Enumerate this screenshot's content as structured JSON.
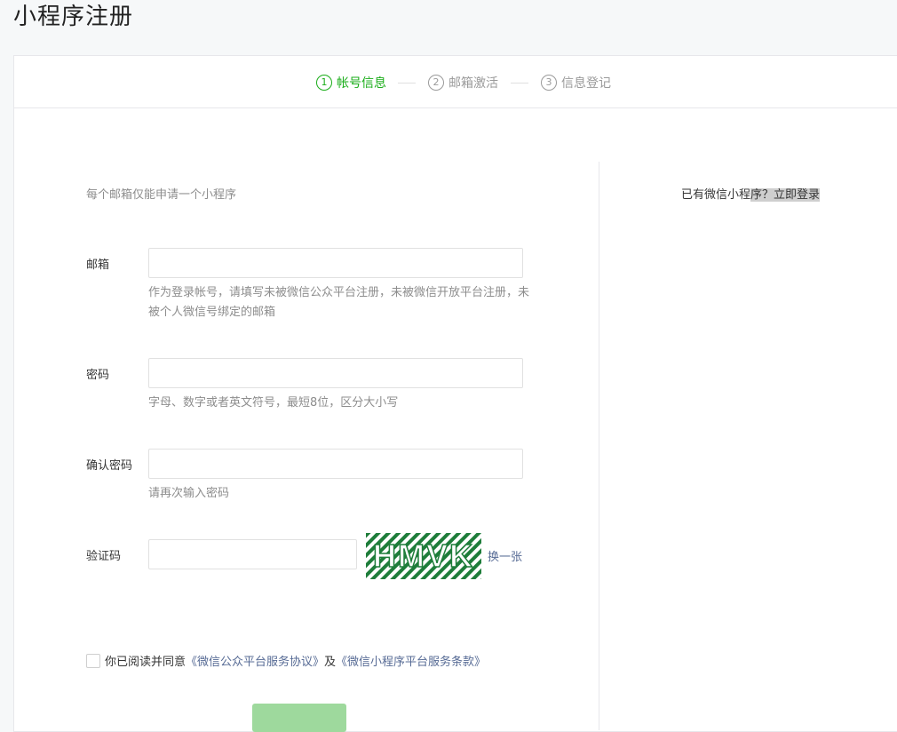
{
  "page": {
    "title": "小程序注册"
  },
  "steps": [
    {
      "num": "1",
      "label": "帐号信息",
      "active": true
    },
    {
      "num": "2",
      "label": "邮箱激活",
      "active": false
    },
    {
      "num": "3",
      "label": "信息登记",
      "active": false
    }
  ],
  "form": {
    "notice": "每个邮箱仅能申请一个小程序",
    "email": {
      "label": "邮箱",
      "value": "",
      "hint": "作为登录帐号，请填写未被微信公众平台注册，未被微信开放平台注册，未被个人微信号绑定的邮箱"
    },
    "password": {
      "label": "密码",
      "value": "",
      "hint": "字母、数字或者英文符号，最短8位，区分大小写"
    },
    "confirm": {
      "label": "确认密码",
      "value": "",
      "hint": "请再次输入密码"
    },
    "captcha": {
      "label": "验证码",
      "value": "",
      "image_text": "HMVK",
      "refresh": "换一张"
    },
    "agreement": {
      "prefix": "你已阅读并同意",
      "link1": "《微信公众平台服务协议》",
      "middle": "及",
      "link2": "《微信小程序平台服务条款》",
      "checked": false
    },
    "submit_label": ""
  },
  "side": {
    "login_prefix": "已有微信小程",
    "login_link": "序？立即登录"
  },
  "colors": {
    "accent": "#1aad19",
    "link": "#576b95",
    "muted": "#8d8d8d"
  }
}
